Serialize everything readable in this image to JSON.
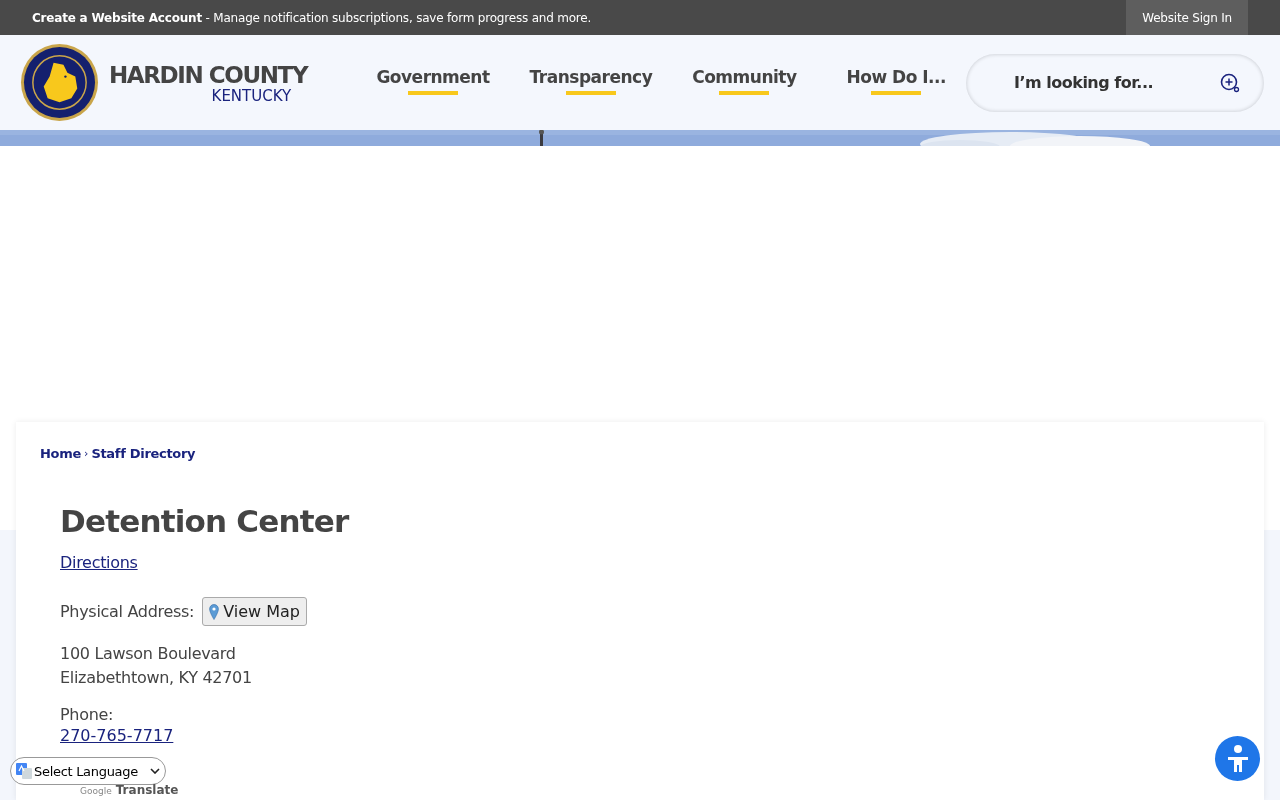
{
  "top_bar": {
    "account_link": "Create a Website Account",
    "account_text": " - Manage notification subscriptions, save form progress and more.",
    "sign_in": "Website Sign In"
  },
  "header": {
    "logo_title": "HARDIN COUNTY",
    "logo_subtitle": "KENTUCKY",
    "nav": [
      {
        "label": "Government"
      },
      {
        "label": "Transparency"
      },
      {
        "label": "Community"
      },
      {
        "label": "How Do I..."
      }
    ],
    "search": {
      "placeholder": "I’m looking for..."
    }
  },
  "breadcrumb": {
    "separator": "›",
    "items": [
      {
        "label": "Home"
      },
      {
        "label": "Staff Directory"
      }
    ]
  },
  "content": {
    "title": "Detention Center",
    "directions": "Directions",
    "address_label": "Physical Address:",
    "view_map": "View Map",
    "address_lines": [
      "100 Lawson Boulevard",
      "Elizabethtown, KY 42701"
    ],
    "phone_label": "Phone:",
    "phone": "270-765-7717"
  },
  "translate": {
    "select": "Select Language",
    "brand": "Google",
    "label": "Translate"
  }
}
